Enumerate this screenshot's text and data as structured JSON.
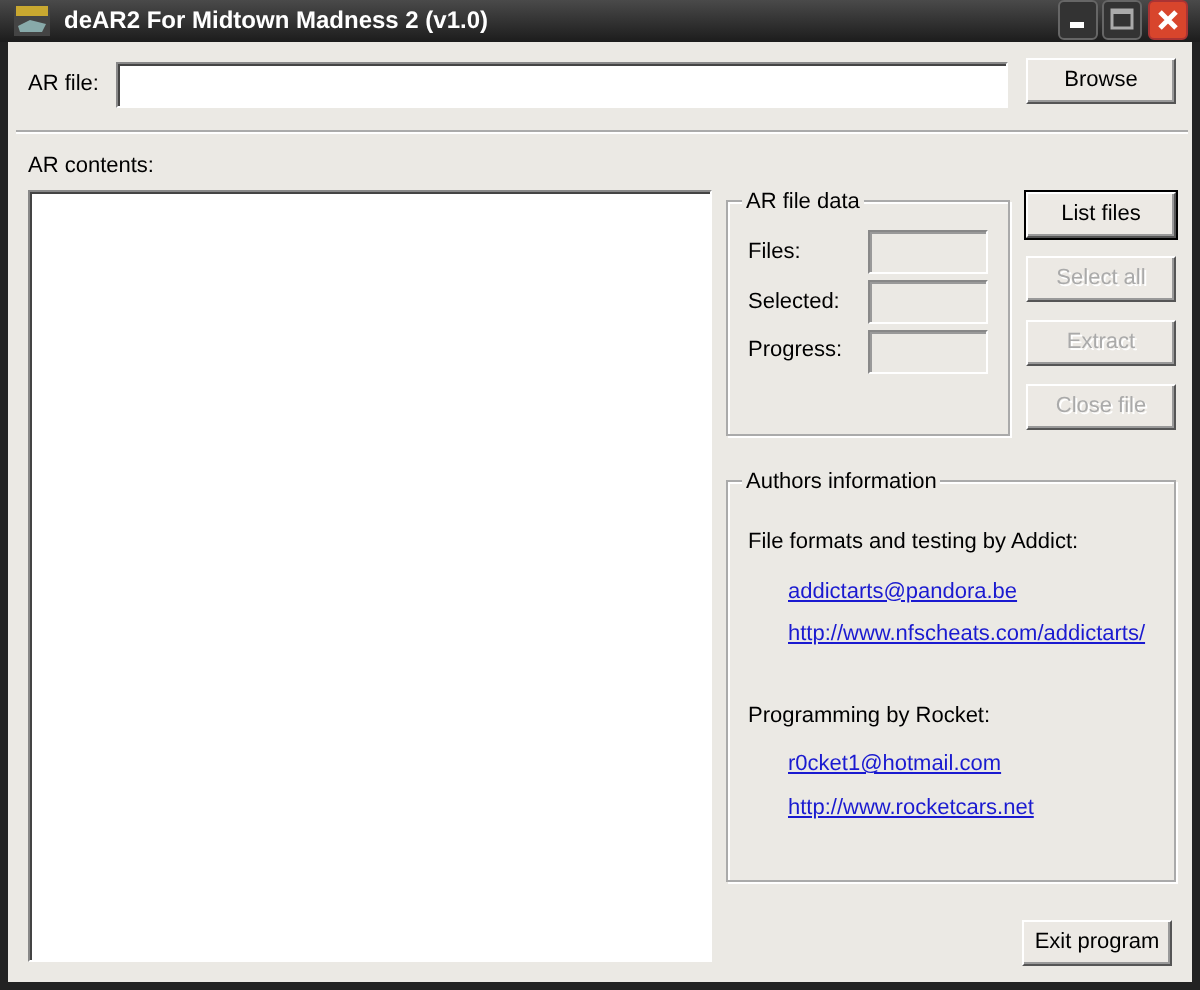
{
  "window": {
    "title": "deAR2 For Midtown Madness 2 (v1.0)"
  },
  "ar_file": {
    "label": "AR file:",
    "browse_button": "Browse"
  },
  "contents": {
    "label": "AR contents:"
  },
  "file_data": {
    "title": "AR file data",
    "fields": [
      {
        "label": "Files:"
      },
      {
        "label": "Selected:"
      },
      {
        "label": "Progress:"
      }
    ]
  },
  "actions": [
    {
      "label": "List files",
      "disabled": false,
      "default": true
    },
    {
      "label": "Select all",
      "disabled": true,
      "default": false
    },
    {
      "label": "Extract",
      "disabled": true,
      "default": false
    },
    {
      "label": "Close file",
      "disabled": true,
      "default": false
    }
  ],
  "authors": {
    "title": "Authors information",
    "sections": [
      {
        "heading": "File formats and testing by Addict:",
        "links": [
          "addictarts@pandora.be",
          "http://www.nfscheats.com/addictarts/"
        ]
      },
      {
        "heading": "Programming by Rocket:",
        "links": [
          "r0cket1@hotmail.com",
          "http://www.rocketcars.net"
        ]
      }
    ]
  },
  "exit_button": "Exit program"
}
